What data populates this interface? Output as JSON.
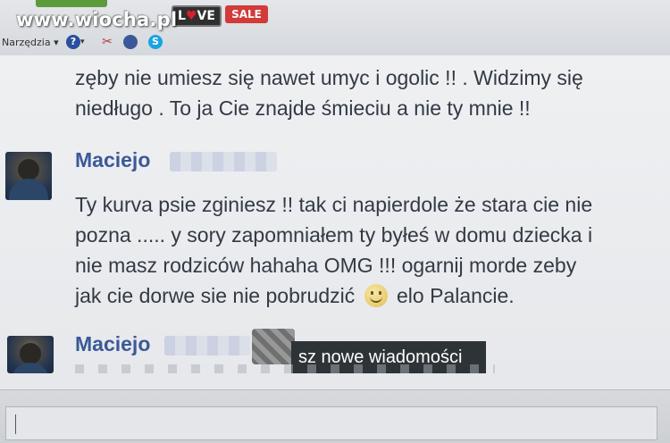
{
  "watermark": "www.wiocha.pl",
  "toolbar": {
    "love_prefix": "L",
    "love_heart": "♥",
    "love_suffix": "VE",
    "sale": "SALE",
    "tools": "Narzędzia ▾",
    "icons": [
      "help-icon",
      "tool-icon",
      "globe-icon",
      "skype-icon"
    ]
  },
  "messages": [
    {
      "lines": [
        "zęby nie umiesz się nawet umyc i ogolic !! . Widzimy się",
        "niedługo . To ja Cie znajde śmieciu a nie ty mnie !!"
      ]
    },
    {
      "sender": "Maciejo",
      "lines": [
        "Ty kurva psie zginiesz !! tak ci napierdole że stara cie nie",
        "pozna ..... y sory zapomniałem ty byłeś w domu dziecka i",
        "nie masz rodziców hahaha OMG !!! ogarnij morde zeby"
      ],
      "last_line_before": "jak cie dorwe sie nie pobrudzić",
      "last_line_after": "elo Palancie."
    },
    {
      "sender": "Maciejo"
    }
  ],
  "tooltip": "sz nowe wiadomości",
  "colors": {
    "sender": "#3b5998",
    "text": "#333a44",
    "tooltip_bg": "#2e3338"
  }
}
